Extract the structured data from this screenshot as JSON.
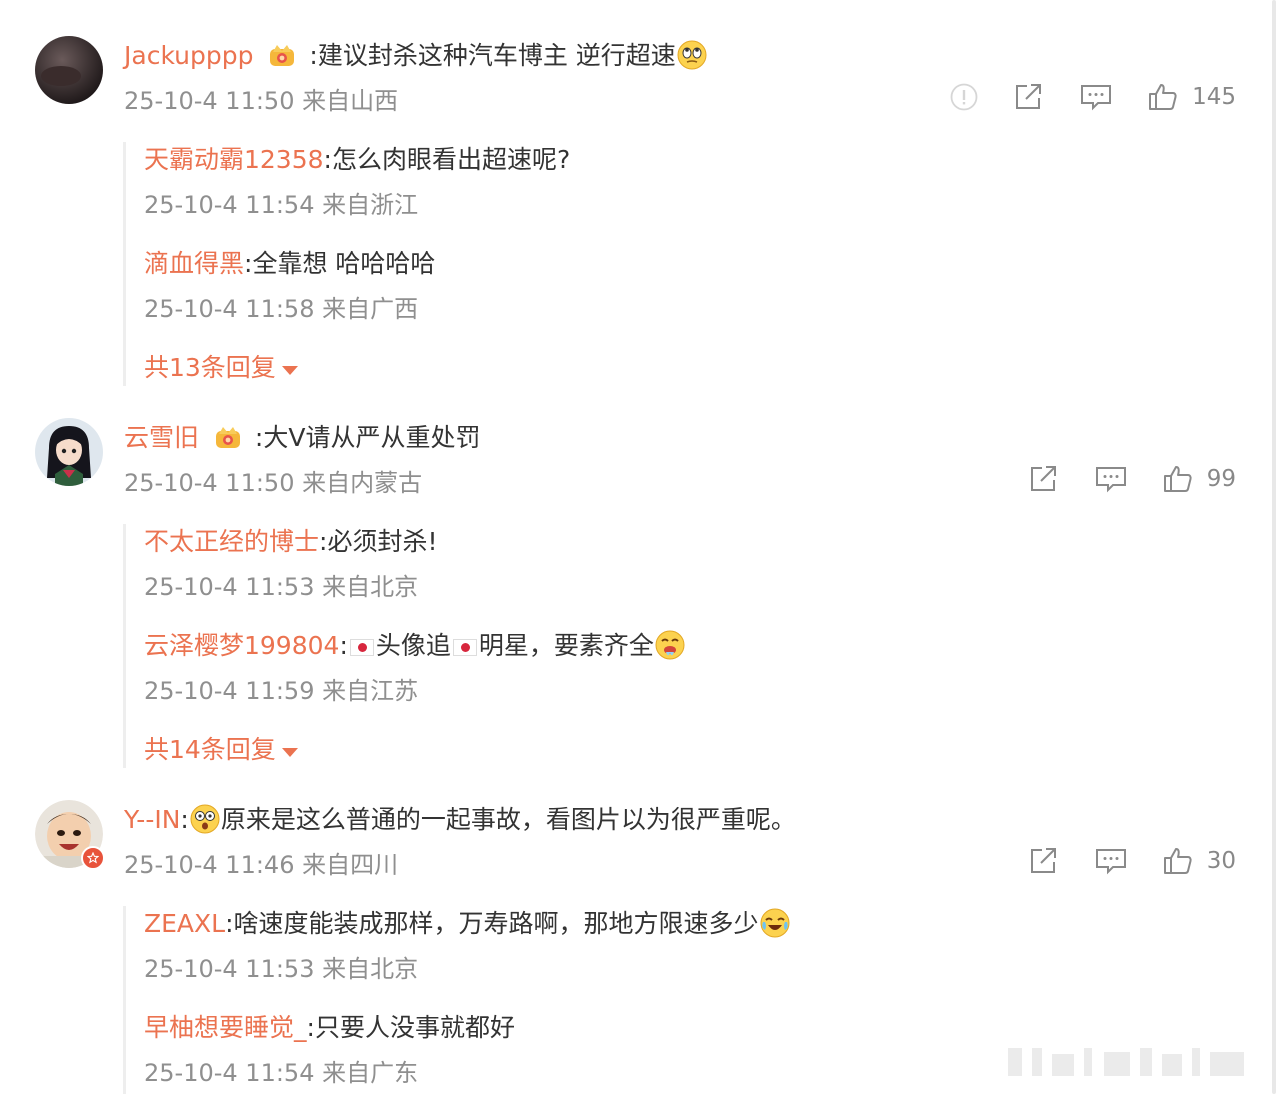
{
  "comments": [
    {
      "user": "Jackupppp",
      "separator": ":",
      "text": "建议封杀这种汽车博主 逆行超速",
      "time": "25-10-4 11:50 来自山西",
      "likes": "145",
      "has_report": true,
      "replies": [
        {
          "user": "天霸动霸12358",
          "text": ":怎么肉眼看出超速呢?",
          "time": "25-10-4 11:54 来自浙江"
        },
        {
          "user": "滴血得黑",
          "text": ":全靠想 哈哈哈哈",
          "time": "25-10-4 11:58 来自广西"
        }
      ],
      "more": "共13条回复"
    },
    {
      "user": "云雪旧",
      "separator": ":",
      "text": "大V请从严从重处罚",
      "time": "25-10-4 11:50 来自内蒙古",
      "likes": "99",
      "has_report": false,
      "replies": [
        {
          "user": "不太正经的博士",
          "text": ":必须封杀!",
          "time": "25-10-4 11:53 来自北京"
        },
        {
          "user": "云泽樱梦199804",
          "text_a": ":",
          "text_b": "头像追",
          "text_c": "明星，要素齐全",
          "time": "25-10-4 11:59 来自江苏"
        }
      ],
      "more": "共14条回复"
    },
    {
      "user": "Y--IN",
      "separator": ":",
      "text": "原来是这么普通的一起事故，看图片以为很严重呢。",
      "time": "25-10-4 11:46 来自四川",
      "likes": "30",
      "has_report": false,
      "replies": [
        {
          "user": "ZEAXL",
          "text": ":啥速度能装成那样，万寿路啊，那地方限速多少",
          "time": "25-10-4 11:53 来自北京"
        },
        {
          "user": "早柚想要睡觉_",
          "text": ":只要人没事就都好",
          "time": "25-10-4 11:54 来自广东"
        }
      ]
    }
  ],
  "colors": {
    "username": "#eb7350",
    "text": "#333333",
    "meta": "#8f8f8f"
  },
  "icons": [
    "report-icon",
    "share-icon",
    "comment-icon",
    "like-icon",
    "vip-crown-icon"
  ]
}
